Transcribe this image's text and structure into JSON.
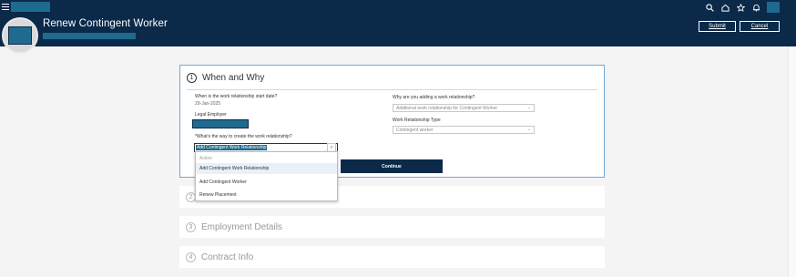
{
  "header": {
    "title": "Renew Contingent Worker",
    "submit_label": "Submit",
    "cancel_label": "Cancel"
  },
  "top_icons": [
    "search-icon",
    "home-icon",
    "star-icon",
    "bell-icon"
  ],
  "section_main": {
    "step": "1",
    "title": "When and Why",
    "start_date_label": "When is the work relationship start date?",
    "start_date_value": "29-Jan-2025",
    "legal_employer_label": "Legal Employer",
    "way_label": "*What's the way to create the work relationship?",
    "way_value": "Add Contingent Work Relationship",
    "reason_label": "Why are you adding a work relationship?",
    "reason_value": "Additional work relationship for Contingent Worker",
    "type_label": "Work Relationship Type",
    "type_value": "Contingent worker",
    "continue_label": "Continue"
  },
  "dropdown": {
    "items": [
      "Action",
      "Add Contingent Work Relationship",
      "Add Contingent Worker",
      "Renew Placement"
    ]
  },
  "sections_collapsed": [
    {
      "step": "2",
      "title": ""
    },
    {
      "step": "3",
      "title": "Employment Details"
    },
    {
      "step": "4",
      "title": "Contract Info"
    }
  ],
  "colors": {
    "header_bg": "#0b2a4a",
    "accent": "#1f6a8f",
    "selection_border": "#6ea8d4"
  }
}
